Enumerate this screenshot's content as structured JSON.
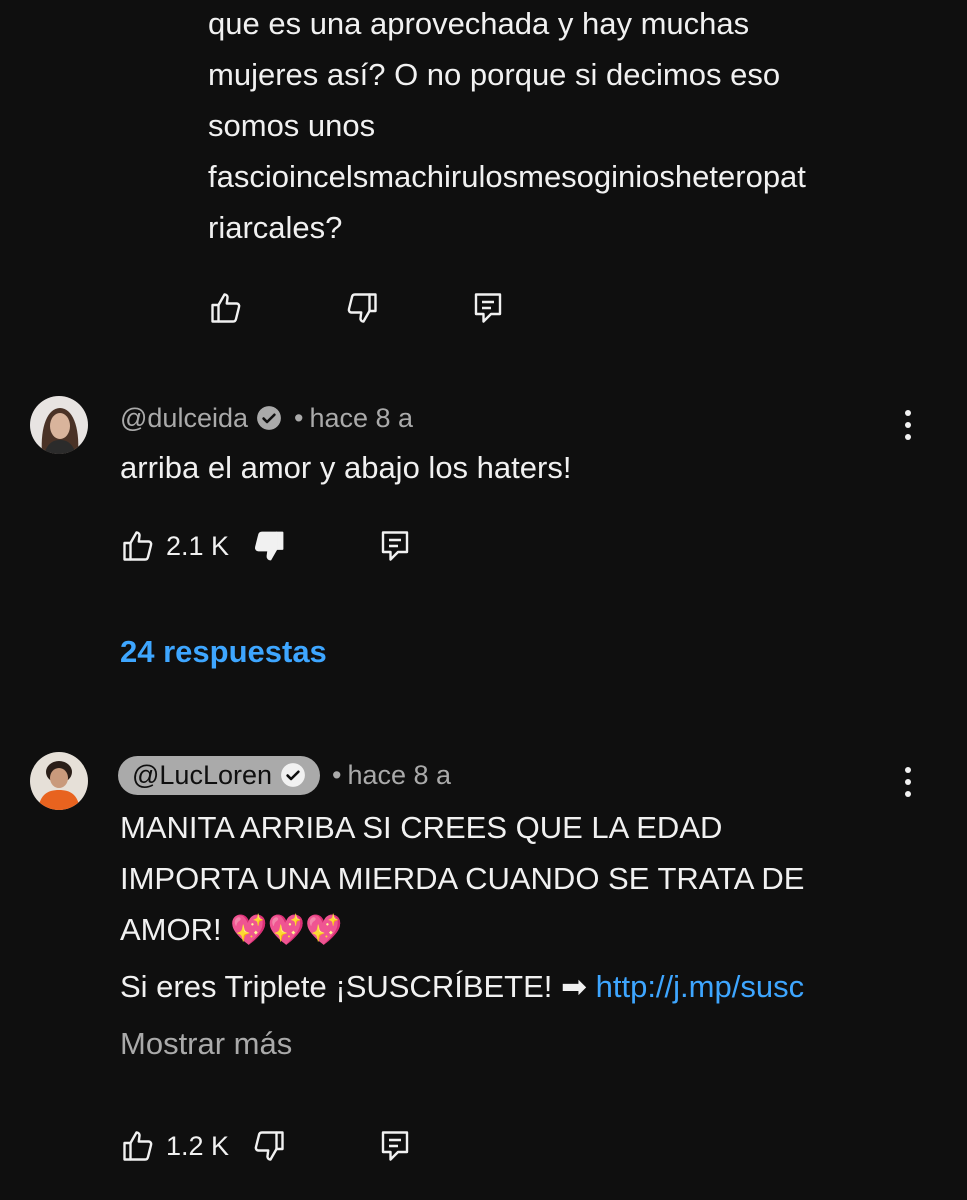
{
  "prev_comment": {
    "lines": [
      "que es una aprovechada y hay muchas",
      "mujeres así? O no porque si decimos eso",
      "somos unos",
      "fascioincelsmachirulosmesoginiosheteropat",
      "riarcales?"
    ]
  },
  "comments": [
    {
      "handle": "@dulceida",
      "time": "hace 8 a",
      "verified": true,
      "text": "arriba el amor y abajo los haters!",
      "likes": "2.1 K",
      "replies": "24 respuestas"
    },
    {
      "handle": "@LucLoren",
      "time": "hace 8 a",
      "verified": true,
      "lines": [
        "MANITA ARRIBA SI CREES QUE LA EDAD",
        "IMPORTA UNA MIERDA CUANDO SE TRATA DE",
        "AMOR!"
      ],
      "emojis": "💖💖💖",
      "subscribe_text": "Si eres Triplete ¡SUSCRÍBETE! ➡",
      "link": "http://j.mp/susc",
      "show_more": "Mostrar más",
      "likes": "1.2 K"
    }
  ],
  "colors": {
    "background": "#0f0f0f",
    "text": "#f1f1f1",
    "secondary": "#aaaaaa",
    "link": "#3ea6ff"
  },
  "icons": [
    "thumbs-up-icon",
    "thumbs-down-icon",
    "reply-icon",
    "verified-icon",
    "more-vert-icon"
  ]
}
